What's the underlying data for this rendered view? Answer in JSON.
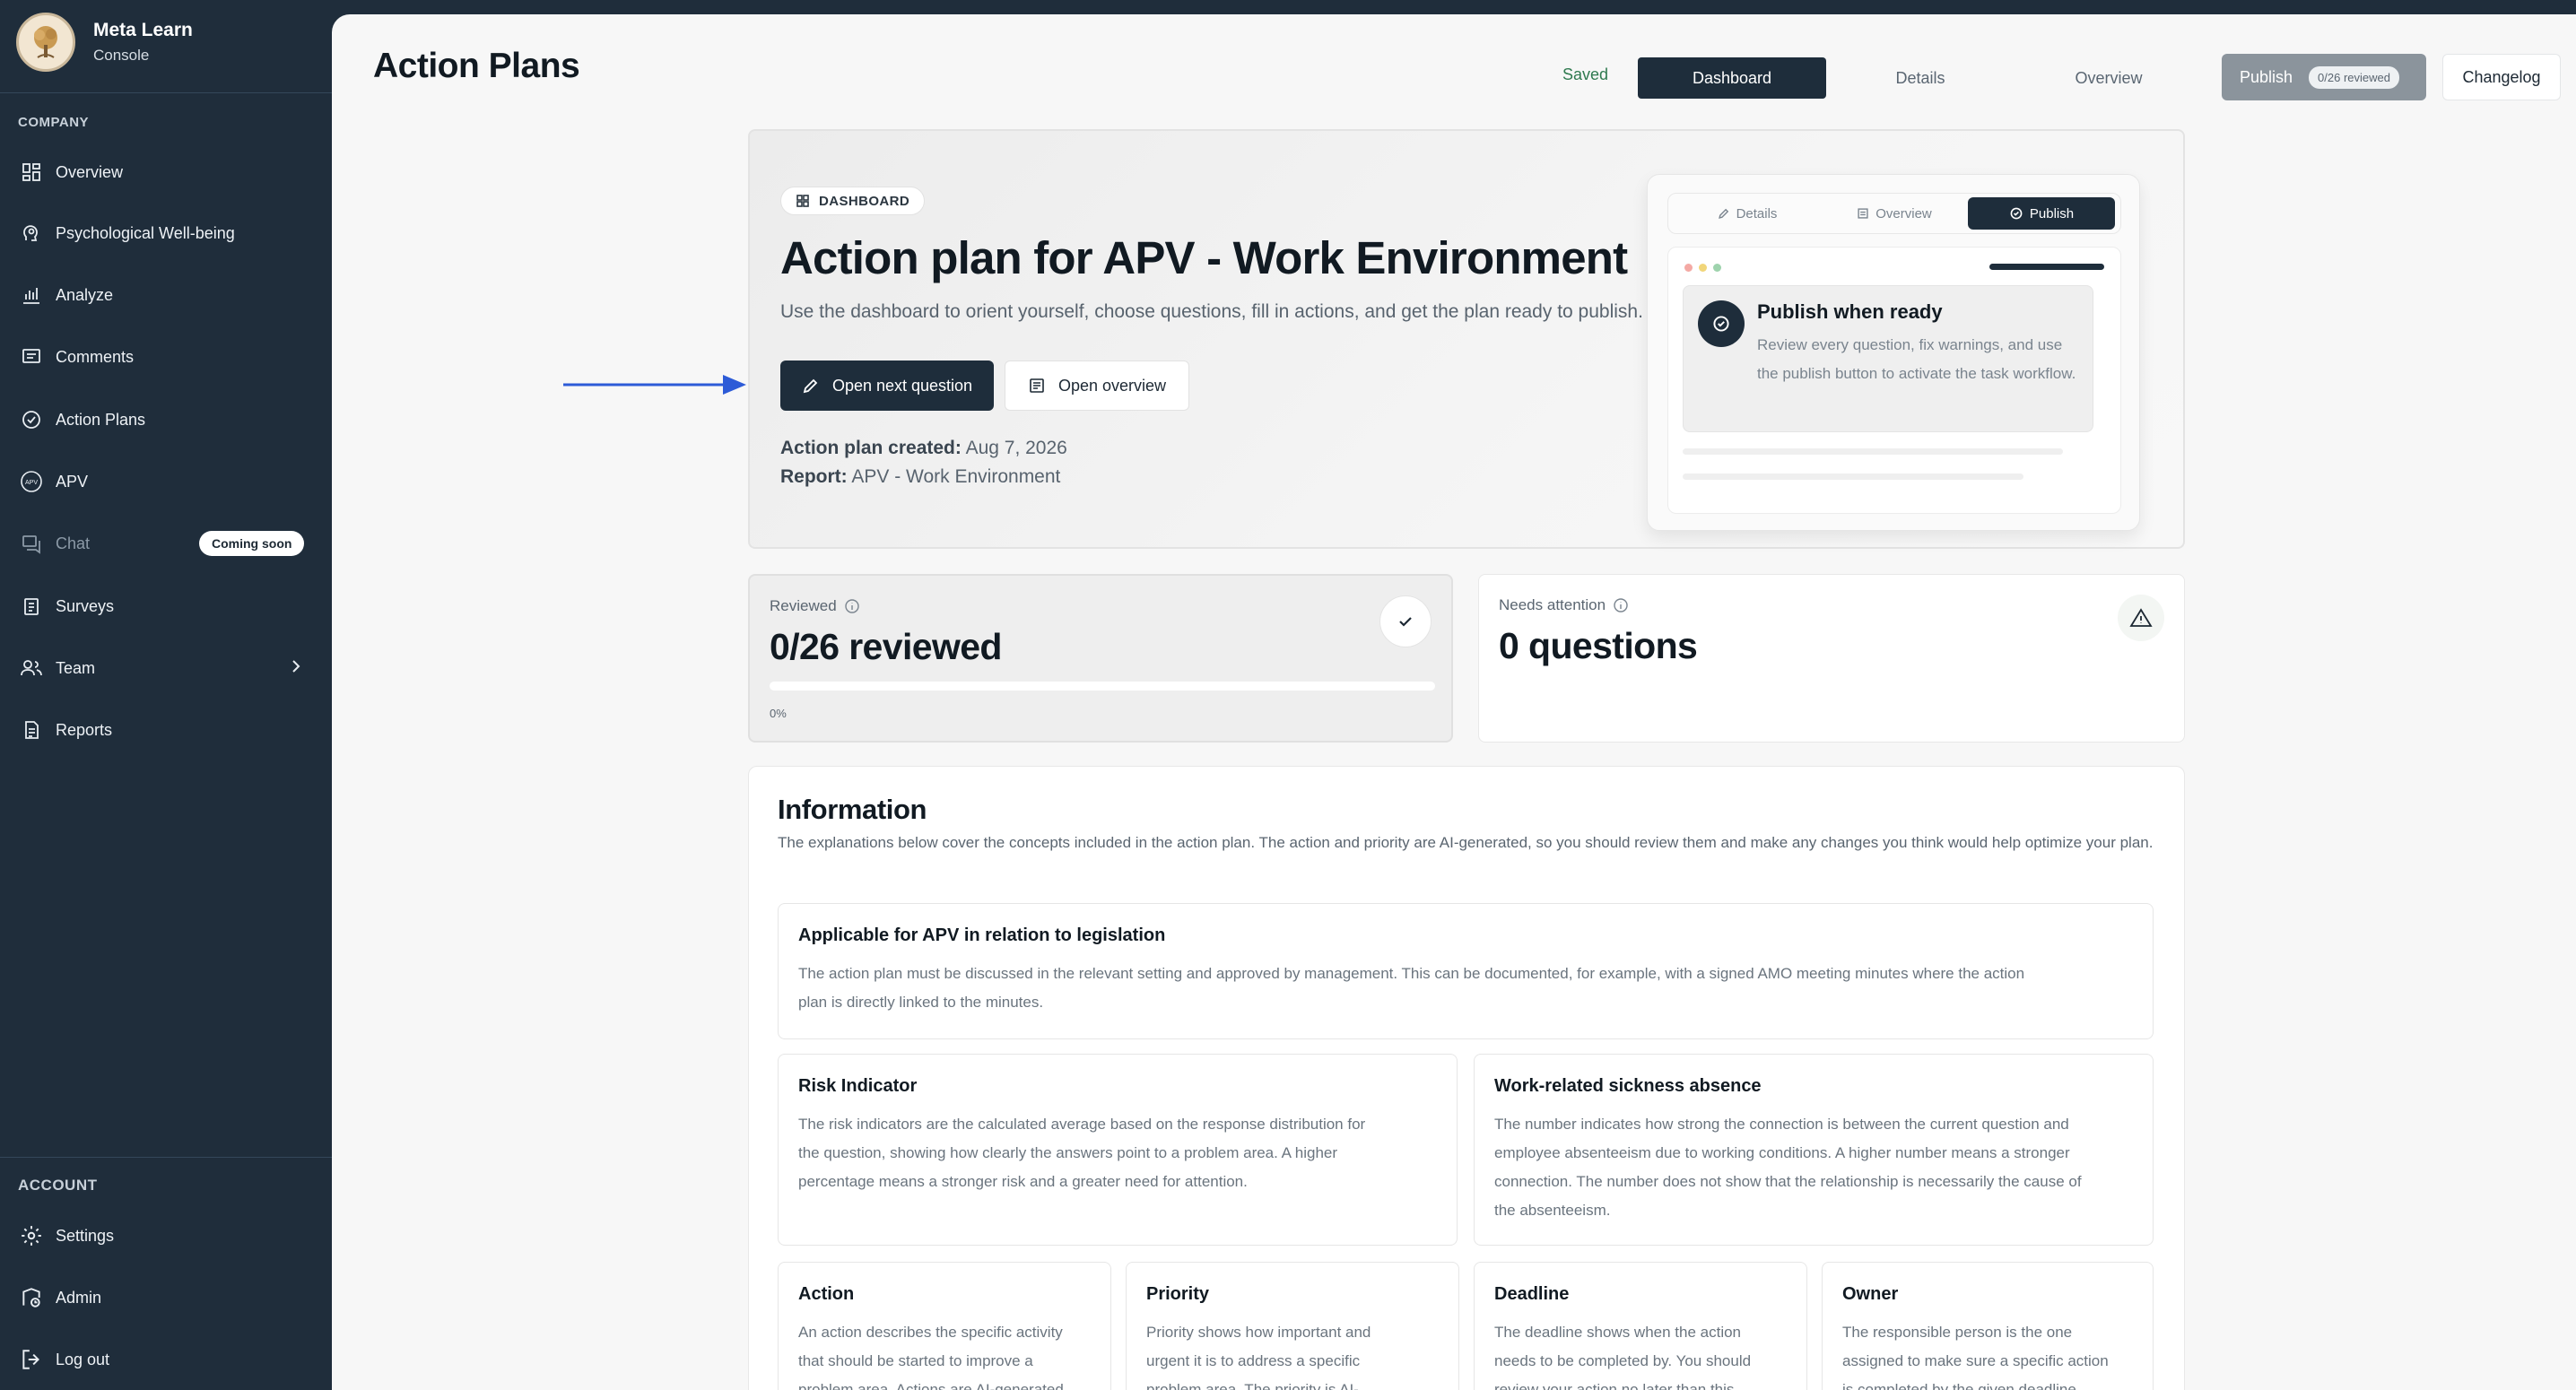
{
  "brand": {
    "name": "Meta Learn",
    "subtitle": "Console"
  },
  "sidebar": {
    "company_label": "COMPANY",
    "items": [
      {
        "label": "Overview",
        "icon": "grid-icon"
      },
      {
        "label": "Psychological Well-being",
        "icon": "head-icon"
      },
      {
        "label": "Analyze",
        "icon": "bar-chart-icon"
      },
      {
        "label": "Comments",
        "icon": "comment-icon"
      },
      {
        "label": "Action Plans",
        "icon": "check-circle-icon"
      },
      {
        "label": "APV",
        "icon": "apv-icon"
      },
      {
        "label": "Chat",
        "icon": "chat-icon",
        "badge": "Coming soon"
      },
      {
        "label": "Surveys",
        "icon": "clipboard-icon"
      },
      {
        "label": "Team",
        "icon": "users-icon"
      },
      {
        "label": "Reports",
        "icon": "document-icon"
      }
    ],
    "account_label": "ACCOUNT",
    "account_items": [
      {
        "label": "Settings",
        "icon": "gear-icon"
      },
      {
        "label": "Admin",
        "icon": "admin-icon"
      },
      {
        "label": "Log out",
        "icon": "logout-icon"
      }
    ]
  },
  "header": {
    "title": "Action Plans",
    "saved": "Saved",
    "tabs": [
      "Dashboard",
      "Details",
      "Overview"
    ],
    "publish_label": "Publish",
    "publish_badge": "0/26 reviewed",
    "changelog": "Changelog"
  },
  "hero": {
    "chip": "DASHBOARD",
    "title": "Action plan for APV - Work Environment",
    "subtitle": "Use the dashboard to orient yourself, choose questions, fill in actions, and get the plan ready to publish.",
    "primary_button": "Open next question",
    "secondary_button": "Open overview",
    "created_label": "Action plan created:",
    "created_value": "Aug 7, 2026",
    "report_label": "Report:",
    "report_value": "APV - Work Environment"
  },
  "preview": {
    "tabs": [
      "Details",
      "Overview",
      "Publish"
    ],
    "card_title": "Publish when ready",
    "card_text": "Review every question, fix warnings, and use the publish button to activate the task workflow."
  },
  "stats": {
    "reviewed_label": "Reviewed",
    "reviewed_value": "0/26 reviewed",
    "reviewed_progress": 0,
    "reviewed_pct": "0%",
    "attention_label": "Needs attention",
    "attention_value": "0 questions"
  },
  "information": {
    "title": "Information",
    "description": "The explanations below cover the concepts included in the action plan. The action and priority are AI-generated, so you should review them and make any changes you think would help optimize your plan.",
    "legislation_title": "Applicable for APV in relation to legislation",
    "legislation_text_1": "The action plan must be discussed in the relevant setting and approved by management. This can be documented, for example, with a signed AMO meeting minutes where the action",
    "legislation_text_2": "plan is directly linked to the minutes.",
    "risk_title": "Risk Indicator",
    "risk_lines": [
      "The risk indicators are the calculated average based on the response distribution for",
      "the question, showing how clearly the answers point to a problem area. A higher",
      "percentage means a stronger risk and a greater need for attention."
    ],
    "sick_title": "Work-related sickness absence",
    "sick_lines": [
      "The number indicates how strong the connection is between the current question and",
      "employee absenteeism due to working conditions. A higher number means a stronger",
      "connection. The number does not show that the relationship is necessarily the cause of",
      "the absenteeism."
    ],
    "action_title": "Action",
    "action_lines": [
      "An action describes the specific activity",
      "that should be started to improve a",
      "problem area. Actions are AI-generated"
    ],
    "priority_title": "Priority",
    "priority_lines": [
      "Priority shows how important and",
      "urgent it is to address a specific",
      "problem area. The priority is AI-"
    ],
    "deadline_title": "Deadline",
    "deadline_lines": [
      "The deadline shows when the action",
      "needs to be completed by. You should",
      "review your action no later than this"
    ],
    "owner_title": "Owner",
    "owner_lines": [
      "The responsible person is the one",
      "assigned to make sure a specific action",
      "is completed by the given deadline."
    ]
  }
}
